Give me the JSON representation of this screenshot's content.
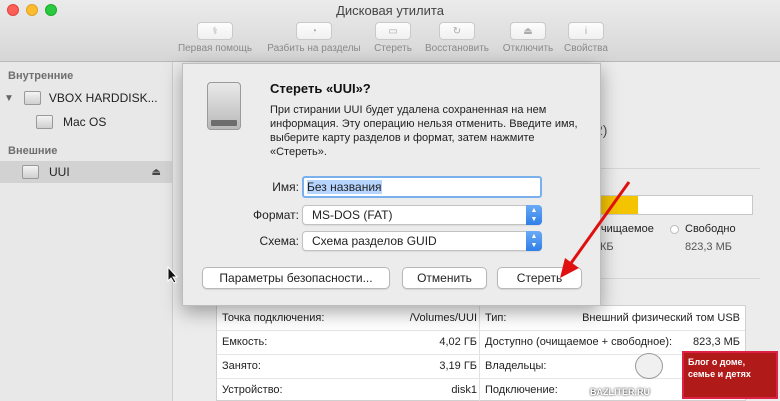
{
  "window": {
    "title": "Дисковая утилита"
  },
  "toolbar": [
    {
      "label": "Первая помощь",
      "icon": "stethoscope-icon"
    },
    {
      "label": "Разбить на разделы",
      "icon": "pie-icon"
    },
    {
      "label": "Стереть",
      "icon": "erase-icon"
    },
    {
      "label": "Восстановить",
      "icon": "restore-icon"
    },
    {
      "label": "Отключить",
      "icon": "unmount-icon"
    },
    {
      "label": "Свойства",
      "icon": "info-icon"
    }
  ],
  "sidebar": {
    "internal_header": "Внутренние",
    "external_header": "Внешние",
    "items": [
      {
        "label": "VBOX HARDDISK..."
      },
      {
        "label": "Mac OS"
      },
      {
        "label": "UUI"
      }
    ]
  },
  "dialog": {
    "title": "Стереть «UUI»?",
    "message": "При стирании UUI будет удалена сохраненная на нем информация. Эту операцию нельзя отменить. Введите имя, выберите карту разделов и формат, затем нажмите «Стереть».",
    "name_label": "Имя:",
    "name_value": "Без названия",
    "format_label": "Формат:",
    "format_value": "MS-DOS (FAT)",
    "scheme_label": "Схема:",
    "scheme_value": "Схема разделов GUID",
    "security_button": "Параметры безопасности...",
    "cancel_button": "Отменить",
    "erase_button": "Стереть"
  },
  "background": {
    "partial_number": "2)",
    "usage_fraction": 0.28,
    "purgeable_label": "очищаемое",
    "purgeable_value": "КБ",
    "free_label": "Свободно",
    "free_value": "823,3 МБ"
  },
  "info": {
    "left": [
      {
        "key": "Точка подключения:",
        "value": "/Volumes/UUI"
      },
      {
        "key": "Емкость:",
        "value": "4,02 ГБ"
      },
      {
        "key": "Занято:",
        "value": "3,19 ГБ"
      },
      {
        "key": "Устройство:",
        "value": "disk1"
      }
    ],
    "right": [
      {
        "key": "Тип:",
        "value": "Внешний физический том USB"
      },
      {
        "key": "Доступно (очищаемое + свободное):",
        "value": "823,3 МБ"
      },
      {
        "key": "Владельцы:",
        "value": ""
      },
      {
        "key": "Подключение:",
        "value": ""
      }
    ]
  },
  "watermark": {
    "site": "BAZLITER.RU",
    "text": "Блог о доме, семье и детях"
  }
}
